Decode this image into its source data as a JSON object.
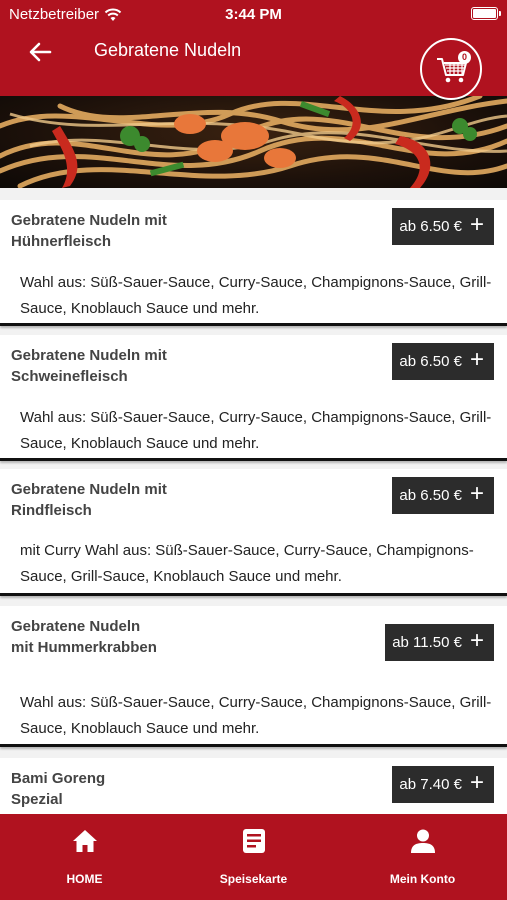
{
  "status_bar": {
    "carrier": "Netzbetreiber",
    "time": "3:44 PM"
  },
  "header": {
    "title": "Gebratene Nudeln",
    "cart_count": "0"
  },
  "items": [
    {
      "name": "Gebratene Nudeln mit Hühnerfleisch",
      "price": "ab 6.50 €",
      "description": "Wahl aus: Süß-Sauer-Sauce, Curry-Sauce, Champignons-Sauce, Grill-Sauce, Knoblauch Sauce und mehr."
    },
    {
      "name": "Gebratene Nudeln mit Schweinefleisch",
      "price": "ab 6.50 €",
      "description": "Wahl aus: Süß-Sauer-Sauce, Curry-Sauce, Champignons-Sauce, Grill-Sauce, Knoblauch Sauce und mehr."
    },
    {
      "name": "Gebratene Nudeln mit Rindfleisch",
      "price": "ab 6.50 €",
      "description": "mit Curry Wahl aus: Süß-Sauer-Sauce, Curry-Sauce, Champignons-Sauce, Grill-Sauce, Knoblauch Sauce und mehr."
    },
    {
      "name": "Gebratene Nudeln mit Hummerkrabben",
      "price": "ab 11.50 €",
      "description": "Wahl aus: Süß-Sauer-Sauce, Curry-Sauce, Champignons-Sauce, Grill-Sauce, Knoblauch Sauce und mehr."
    },
    {
      "name": "Bami Goreng Spezial",
      "price": "ab 7.40 €",
      "description": ""
    }
  ],
  "bottom_nav": [
    {
      "label": "HOME",
      "icon": "home-icon"
    },
    {
      "label": "Speisekarte",
      "icon": "menu-card-icon"
    },
    {
      "label": "Mein Konto",
      "icon": "account-icon"
    }
  ],
  "colors": {
    "primary": "#b0121f",
    "price_button": "#2c2c2c"
  }
}
